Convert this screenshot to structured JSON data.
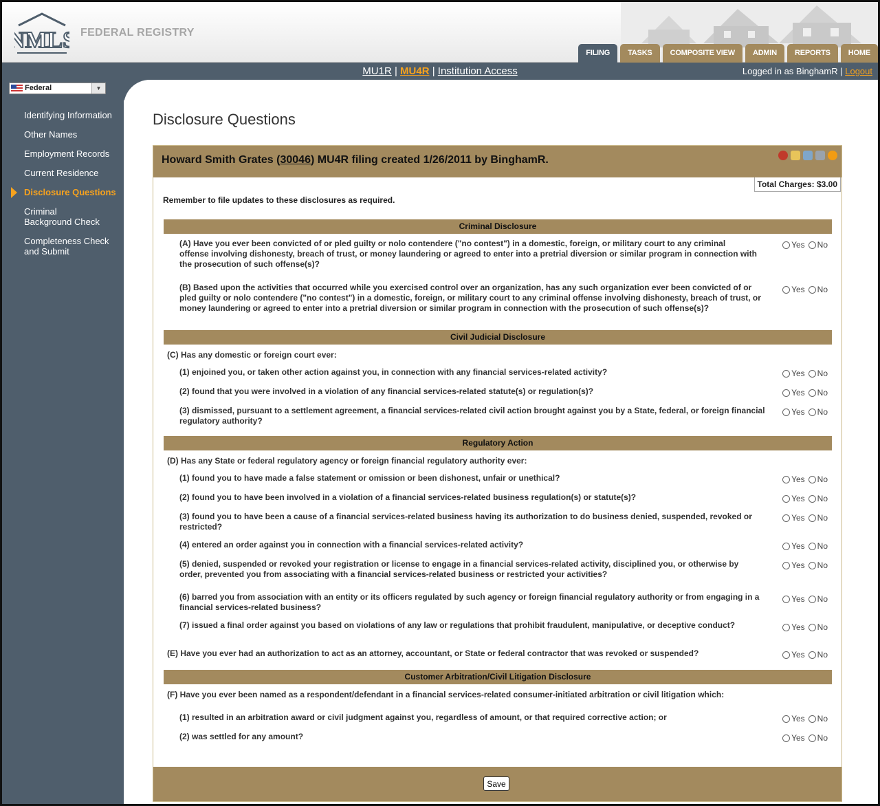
{
  "header": {
    "app_title": "FEDERAL REGISTRY",
    "logo_text": "NMLS",
    "tabs": [
      {
        "label": "FILING",
        "active": true
      },
      {
        "label": "TASKS",
        "active": false
      },
      {
        "label": "COMPOSITE VIEW",
        "active": false
      },
      {
        "label": "ADMIN",
        "active": false
      },
      {
        "label": "REPORTS",
        "active": false
      },
      {
        "label": "HOME",
        "active": false
      }
    ]
  },
  "subnav": {
    "mu1r": "MU1R",
    "sep1": " | ",
    "mu4r": "MU4R",
    "sep2": " | ",
    "institution": "Institution Access",
    "logged_in": "Logged in as BinghamR",
    "sep3": " | ",
    "logout": "Logout"
  },
  "sidebar": {
    "selector": "Federal",
    "items": [
      {
        "label": "Identifying Information"
      },
      {
        "label": "Other Names"
      },
      {
        "label": "Employment Records"
      },
      {
        "label": "Current Residence"
      },
      {
        "label": "Disclosure Questions",
        "active": true
      },
      {
        "label": "Criminal Background Check"
      },
      {
        "label": "Completeness Check and Submit"
      }
    ]
  },
  "main": {
    "page_title": "Disclosure Questions",
    "panel_head_prefix": "Howard Smith Grates (",
    "panel_head_id": "30046",
    "panel_head_suffix": ") MU4R filing created 1/26/2011 by BinghamR.",
    "total_charges": "Total Charges: $3.00",
    "remember": "Remember to file updates to these disclosures as required.",
    "yes_label": "Yes",
    "no_label": "No",
    "save_label": "Save",
    "sections": {
      "criminal": "Criminal Disclosure",
      "civil": "Civil Judicial Disclosure",
      "regulatory": "Regulatory Action",
      "arbitration": "Customer Arbitration/Civil Litigation Disclosure"
    },
    "questions": {
      "a": "(A) Have you ever been convicted of or pled guilty or nolo contendere (\"no contest\") in a domestic, foreign, or military court to any criminal offense involving dishonesty, breach of trust, or money laundering or agreed to enter into a pretrial diversion or similar program in connection with the prosecution of such offense(s)?",
      "b": "(B) Based upon the activities that occurred while you exercised control over an organization, has any such organization ever been convicted of or pled guilty or nolo contendere (\"no contest\") in a domestic, foreign, or military court to any criminal offense involving dishonesty, breach of trust, or money laundering or agreed to enter into a pretrial diversion or similar program in connection with the prosecution of such offense(s)?",
      "c": "(C) Has any domestic or foreign court ever:",
      "c1": "(1) enjoined you, or taken other action against you, in connection with any financial services-related activity?",
      "c2": "(2) found that you were involved in a violation of any financial services-related statute(s) or regulation(s)?",
      "c3": "(3) dismissed, pursuant to a settlement agreement, a financial services-related civil action brought against you by a State, federal, or foreign financial regulatory authority?",
      "d": "(D) Has any State or federal regulatory agency or foreign financial regulatory authority ever:",
      "d1": "(1) found you to have made a false statement or omission or been dishonest, unfair or unethical?",
      "d2": "(2) found you to have been involved in a violation of a financial services-related business regulation(s) or statute(s)?",
      "d3": "(3) found you to have been a cause of a financial services-related business having its authorization to do business denied, suspended, revoked or restricted?",
      "d4": "(4) entered an order against you in connection with a financial services-related activity?",
      "d5": "(5) denied, suspended or revoked your registration or license to engage in a financial services-related activity, disciplined you, or otherwise by order, prevented you from associating with a financial services-related business or restricted your activities?",
      "d6": "(6) barred you from association with an entity or its officers regulated by such agency or foreign financial regulatory authority or from engaging in a financial services-related business?",
      "d7": "(7) issued a final order against you based on violations of any law or regulations that prohibit fraudulent, manipulative, or deceptive conduct?",
      "e": "(E) Have you ever had an authorization to act as an attorney, accountant, or State or federal contractor that was revoked or suspended?",
      "f": "(F) Have you ever been named as a respondent/defendant in a financial services-related consumer-initiated arbitration or civil litigation which:",
      "f1": "(1) resulted in an arbitration award or civil judgment against you, regardless of amount, or that required corrective action; or",
      "f2": "(2) was settled for any amount?"
    }
  }
}
